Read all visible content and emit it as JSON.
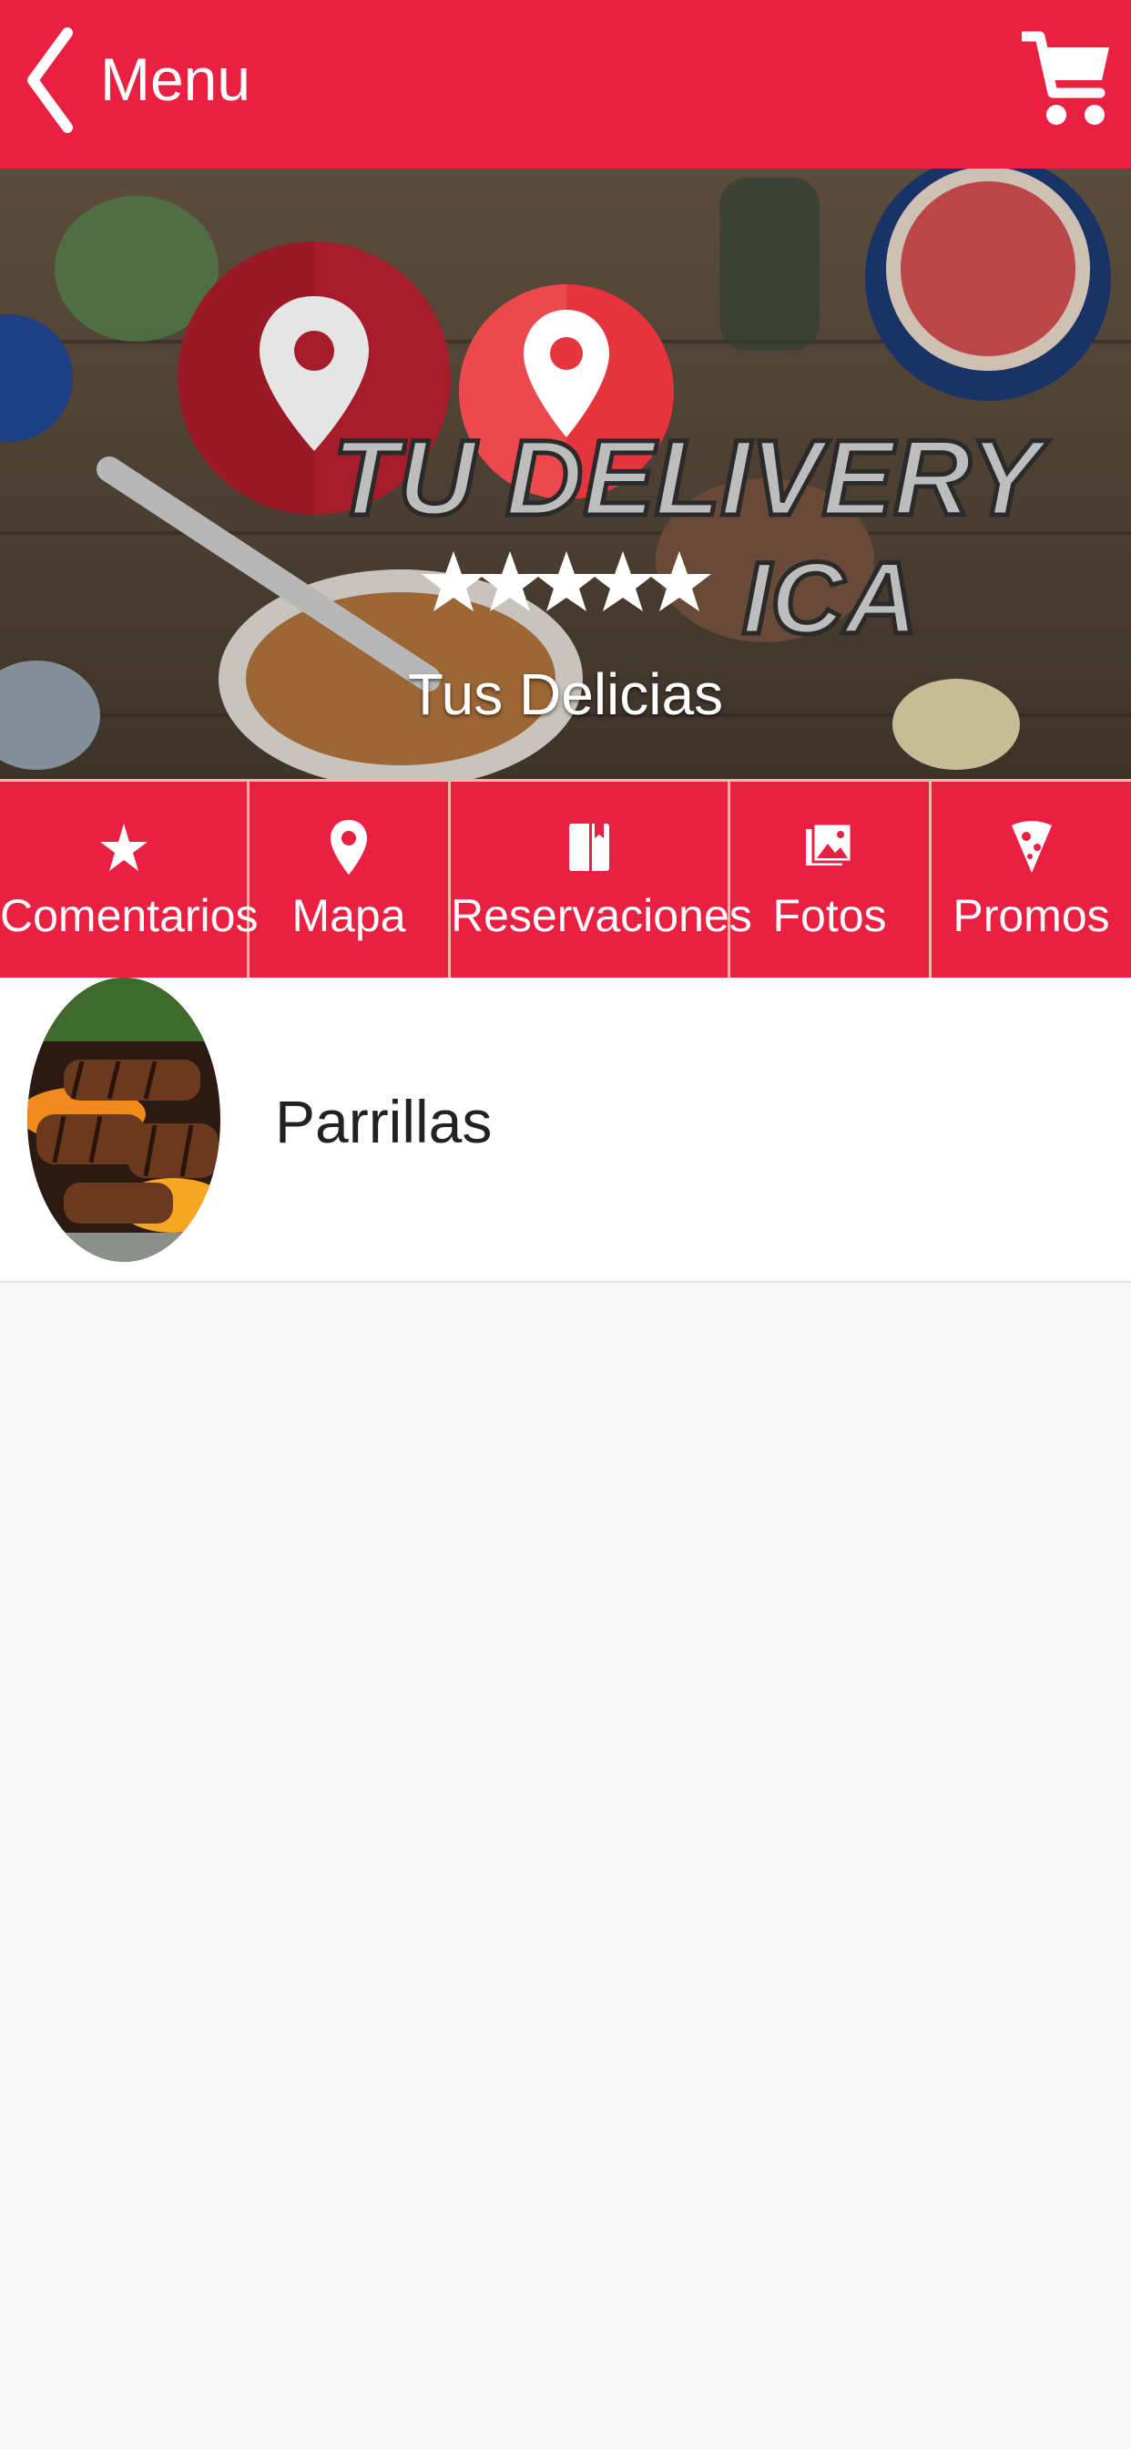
{
  "header": {
    "title": "Menu",
    "back_icon": "chevron-left-icon",
    "cart_icon": "cart-icon"
  },
  "banner": {
    "logo_line1": "TU DELIVERY",
    "logo_line2": "ICA",
    "subtitle": "Tus Delicias",
    "rating_stars": 5
  },
  "tabs": [
    {
      "label": "Comentarios",
      "icon": "star-icon"
    },
    {
      "label": "Mapa",
      "icon": "map-pin-icon"
    },
    {
      "label": "Reservaciones",
      "icon": "book-icon"
    },
    {
      "label": "Fotos",
      "icon": "photos-icon"
    },
    {
      "label": "Promos",
      "icon": "pizza-icon"
    }
  ],
  "categories": [
    {
      "label": "Parrillas",
      "image": "grilled-meat-thumbnail"
    }
  ],
  "colors": {
    "primary": "#e92042",
    "divider": "#f4b6a4",
    "background": "#f8f8f8"
  }
}
